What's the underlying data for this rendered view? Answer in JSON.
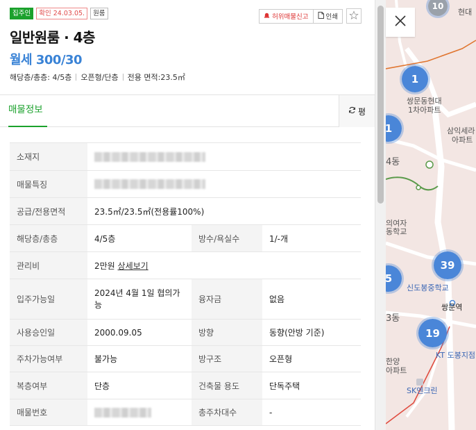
{
  "badges": {
    "status": "집주인",
    "confirmed": "확인 24.03.05.",
    "type": "원룸"
  },
  "actions": {
    "report": "허위매물신고",
    "print": "인쇄"
  },
  "listing": {
    "title": "일반원룸 · 4층",
    "price": "월세 300/30",
    "summary": [
      "해당층/총층: 4/5층",
      "오픈형/단층",
      "전용 면적:23.5㎡"
    ]
  },
  "tabs": {
    "active": "매물정보",
    "pyeong": "평"
  },
  "info": {
    "address_label": "소재지",
    "feature_label": "매물특징",
    "area_label": "공급/전용면적",
    "area_value": "23.5㎡/23.5㎡(전용률100%)",
    "floor_label": "해당층/총층",
    "floor_value": "4/5층",
    "rooms_label": "방수/욕실수",
    "rooms_value": "1/-개",
    "fee_label": "관리비",
    "fee_value": "2만원",
    "fee_link": "상세보기",
    "movein_label": "입주가능일",
    "movein_value": "2024년 4월 1일 협의가능",
    "loan_label": "융자금",
    "loan_value": "없음",
    "approval_label": "사용승인일",
    "approval_value": "2000.09.05",
    "direction_label": "방향",
    "direction_value": "동향(안방 기준)",
    "parking_label": "주차가능여부",
    "parking_value": "불가능",
    "structure_label": "방구조",
    "structure_value": "오픈형",
    "duplex_label": "복층여부",
    "duplex_value": "단층",
    "usage_label": "건축물 용도",
    "usage_value": "단독주택",
    "number_label": "매물번호",
    "total_parking_label": "총주차대수",
    "total_parking_value": "-"
  },
  "map": {
    "clusters": [
      "10",
      "1",
      "1",
      "39",
      "5",
      "19"
    ],
    "labels": {
      "hyundae": "현대",
      "apt1": "쌍문동현대",
      "apt1b": "1차아파트",
      "samik": "삼익세라",
      "samikb": "아파트",
      "dong4": "4동",
      "girls": "의여자",
      "girlsb": "동학교",
      "shindo": "신도봉중학교",
      "station": "쌍문역",
      "dong3": "3동",
      "hanyang": "한양",
      "hanyangb": "아파트",
      "kt": "KT 도봉지점",
      "sk": "SK엔크린"
    }
  }
}
